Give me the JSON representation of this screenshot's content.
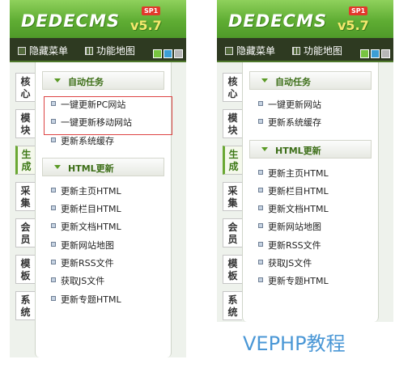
{
  "logo": {
    "text": "DEDECMS",
    "version": "v5.7",
    "badge": "SP1"
  },
  "toolbar": {
    "hide_menu": "隐藏菜单",
    "func_map": "功能地图"
  },
  "swatch_colors": [
    "#78c440",
    "#3c9ed5",
    "#b8b8b8"
  ],
  "tabs": [
    "核心",
    "模块",
    "生成",
    "采集",
    "会员",
    "模板",
    "系统"
  ],
  "panel1": {
    "sections": [
      {
        "title": "自动任务",
        "items": [
          "一键更新PC网站",
          "一键更新移动网站",
          "更新系统缓存"
        ]
      },
      {
        "title": "HTML更新",
        "items": [
          "更新主页HTML",
          "更新栏目HTML",
          "更新文档HTML",
          "更新网站地图",
          "更新RSS文件",
          "获取JS文件",
          "更新专题HTML"
        ]
      }
    ]
  },
  "panel2": {
    "sections": [
      {
        "title": "自动任务",
        "items": [
          "一键更新网站",
          "更新系统缓存"
        ]
      },
      {
        "title": "HTML更新",
        "items": [
          "更新主页HTML",
          "更新栏目HTML",
          "更新文档HTML",
          "更新网站地图",
          "更新RSS文件",
          "获取JS文件",
          "更新专题HTML"
        ]
      }
    ]
  },
  "watermark": "VEPHP教程"
}
